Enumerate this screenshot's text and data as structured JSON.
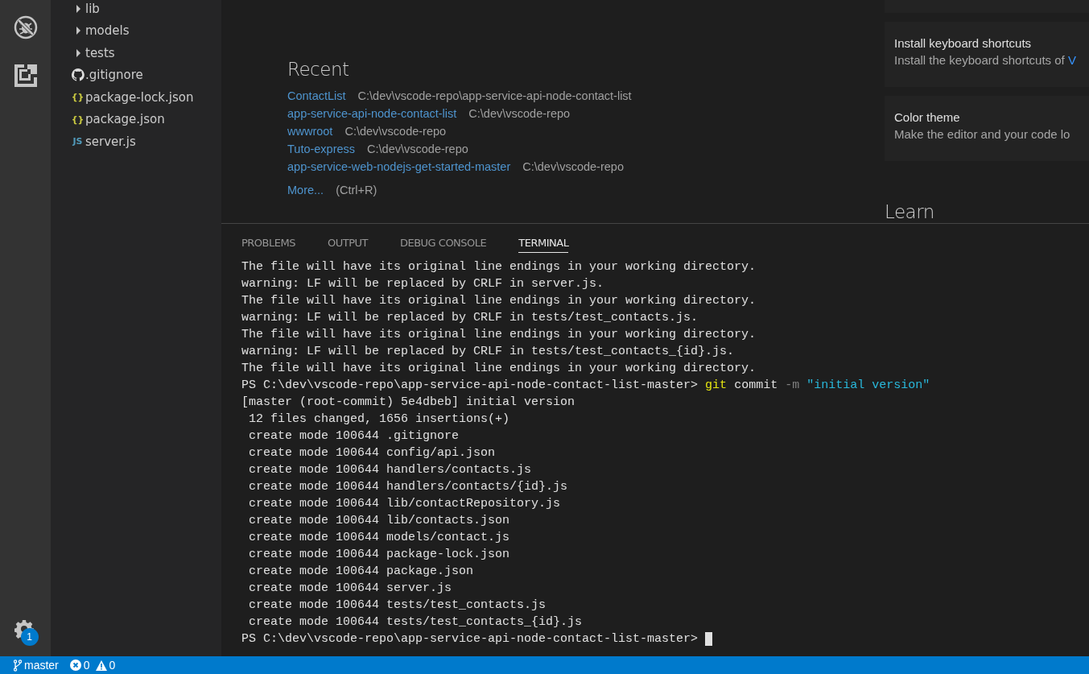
{
  "activity_bar": {
    "settings_badge": "1"
  },
  "explorer": {
    "items": [
      {
        "kind": "folder",
        "name": "lib",
        "expanded": false
      },
      {
        "kind": "folder",
        "name": "models",
        "expanded": false
      },
      {
        "kind": "folder",
        "name": "tests",
        "expanded": false
      },
      {
        "kind": "git",
        "name": ".gitignore"
      },
      {
        "kind": "json",
        "name": "package-lock.json",
        "glyph": "{}"
      },
      {
        "kind": "json",
        "name": "package.json",
        "glyph": "{}"
      },
      {
        "kind": "js",
        "name": "server.js",
        "glyph": "JS"
      }
    ]
  },
  "welcome": {
    "recent": {
      "title": "Recent",
      "items": [
        {
          "name": "ContactList",
          "path": "C:\\dev\\vscode-repo\\app-service-api-node-contact-list"
        },
        {
          "name": "app-service-api-node-contact-list",
          "path": "C:\\dev\\vscode-repo"
        },
        {
          "name": "wwwroot",
          "path": "C:\\dev\\vscode-repo"
        },
        {
          "name": "Tuto-express",
          "path": "C:\\dev\\vscode-repo"
        },
        {
          "name": "app-service-web-nodejs-get-started-master",
          "path": "C:\\dev\\vscode-repo"
        }
      ],
      "more": "More...",
      "shortcut": "(Ctrl+R)"
    },
    "cards": [
      {
        "title": "Install keyboard shortcuts",
        "description": "Install the keyboard shortcuts of ",
        "link": "V"
      },
      {
        "title": "Color theme",
        "description": "Make the editor and your code lo"
      }
    ],
    "learn_title": "Learn"
  },
  "panel": {
    "tabs": [
      {
        "label": "PROBLEMS",
        "selected": false
      },
      {
        "label": "OUTPUT",
        "selected": false
      },
      {
        "label": "DEBUG CONSOLE",
        "selected": false
      },
      {
        "label": "TERMINAL",
        "selected": true
      }
    ],
    "terminal": [
      {
        "kind": "output",
        "text": "The file will have its original line endings in your working directory."
      },
      {
        "kind": "output",
        "text": "warning: LF will be replaced by CRLF in server.js."
      },
      {
        "kind": "output",
        "text": "The file will have its original line endings in your working directory."
      },
      {
        "kind": "output",
        "text": "warning: LF will be replaced by CRLF in tests/test_contacts.js."
      },
      {
        "kind": "output",
        "text": "The file will have its original line endings in your working directory."
      },
      {
        "kind": "output",
        "text": "warning: LF will be replaced by CRLF in tests/test_contacts_{id}.js."
      },
      {
        "kind": "output",
        "text": "The file will have its original line endings in your working directory."
      },
      {
        "kind": "command",
        "prompt": "PS C:\\dev\\vscode-repo\\app-service-api-node-contact-list-master>",
        "tokens": [
          {
            "kind": "program",
            "text": "git"
          },
          {
            "kind": "arg",
            "text": "commit"
          },
          {
            "kind": "flag",
            "text": "-m"
          },
          {
            "kind": "string",
            "text": "\"initial version\""
          }
        ]
      },
      {
        "kind": "output",
        "text": "[master (root-commit) 5e4dbeb] initial version"
      },
      {
        "kind": "output",
        "text": " 12 files changed, 1656 insertions(+)"
      },
      {
        "kind": "output",
        "text": " create mode 100644 .gitignore"
      },
      {
        "kind": "output",
        "text": " create mode 100644 config/api.json"
      },
      {
        "kind": "output",
        "text": " create mode 100644 handlers/contacts.js"
      },
      {
        "kind": "output",
        "text": " create mode 100644 handlers/contacts/{id}.js"
      },
      {
        "kind": "output",
        "text": " create mode 100644 lib/contactRepository.js"
      },
      {
        "kind": "output",
        "text": " create mode 100644 lib/contacts.json"
      },
      {
        "kind": "output",
        "text": " create mode 100644 models/contact.js"
      },
      {
        "kind": "output",
        "text": " create mode 100644 package-lock.json"
      },
      {
        "kind": "output",
        "text": " create mode 100644 package.json"
      },
      {
        "kind": "output",
        "text": " create mode 100644 server.js"
      },
      {
        "kind": "output",
        "text": " create mode 100644 tests/test_contacts.js"
      },
      {
        "kind": "output",
        "text": " create mode 100644 tests/test_contacts_{id}.js"
      },
      {
        "kind": "prompt",
        "prompt": "PS C:\\dev\\vscode-repo\\app-service-api-node-contact-list-master>",
        "cursor": true
      }
    ]
  },
  "status_bar": {
    "branch": "master",
    "errors": "0",
    "warnings": "0"
  }
}
